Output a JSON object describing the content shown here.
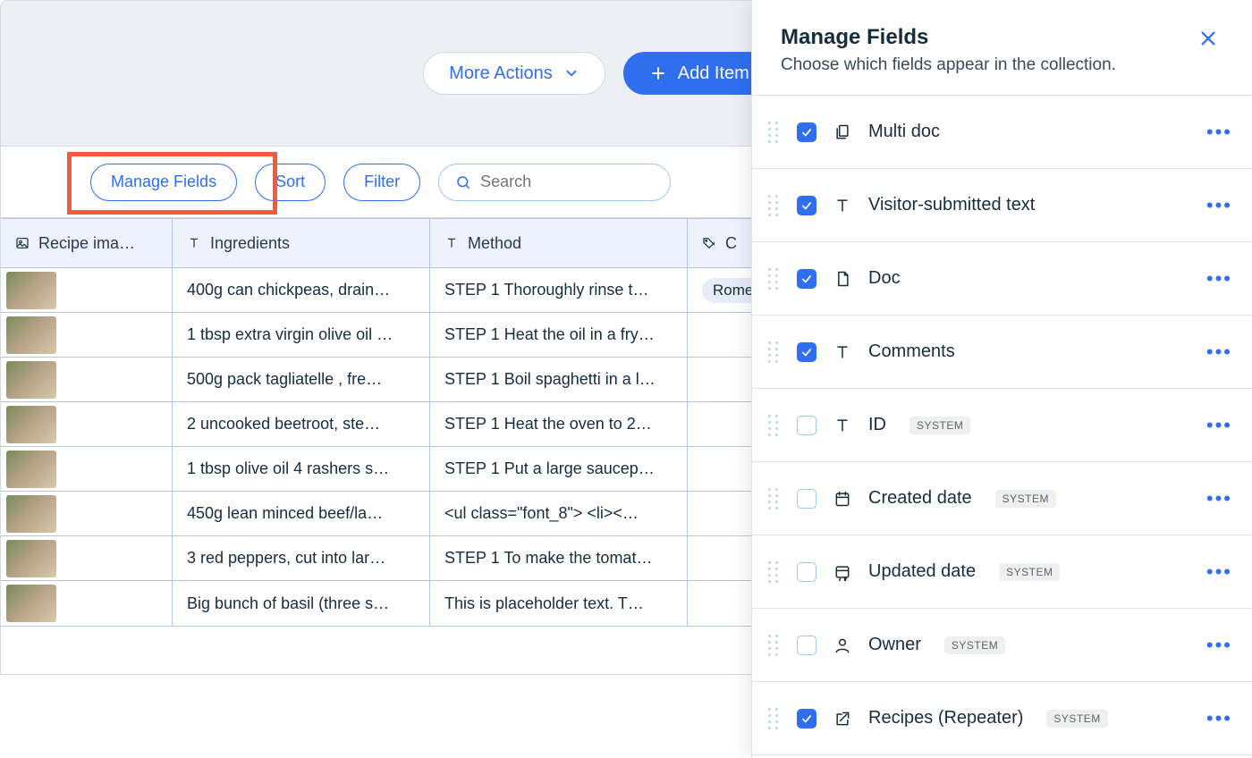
{
  "header": {
    "more_actions": "More Actions",
    "add_item": "Add Item"
  },
  "toolbar": {
    "manage_fields": "Manage Fields",
    "sort": "Sort",
    "filter": "Filter",
    "search_placeholder": "Search"
  },
  "table": {
    "columns": {
      "recipe_image": "Recipe ima…",
      "ingredients": "Ingredients",
      "method": "Method",
      "cu": "Cu"
    },
    "rows": [
      {
        "ingredients": "400g can chickpeas, drain…",
        "method": "STEP 1 Thoroughly rinse t…",
        "cu": "Rome"
      },
      {
        "ingredients": "1 tbsp extra virgin olive oil …",
        "method": "STEP 1 Heat the oil in a fry…",
        "cu": ""
      },
      {
        "ingredients": "500g pack tagliatelle , fre…",
        "method": "STEP 1 Boil spaghetti in a l…",
        "cu": ""
      },
      {
        "ingredients": "2 uncooked beetroot, ste…",
        "method": "STEP 1 Heat the oven to 2…",
        "cu": ""
      },
      {
        "ingredients": "1 tbsp olive oil 4 rashers s…",
        "method": "STEP 1 Put a large saucep…",
        "cu": ""
      },
      {
        "ingredients": "450g lean minced beef/la…",
        "method": "<ul class=\"font_8\"> <li><…",
        "cu": ""
      },
      {
        "ingredients": "3 red peppers, cut into lar…",
        "method": "STEP 1 To make the tomat…",
        "cu": ""
      },
      {
        "ingredients": "Big bunch of basil (three s…",
        "method": "This is placeholder text. T…",
        "cu": ""
      }
    ]
  },
  "panel": {
    "title": "Manage Fields",
    "subtitle": "Choose which fields appear in the collection.",
    "fields": [
      {
        "label": "Multi doc",
        "checked": true,
        "icon": "multidoc",
        "system": false
      },
      {
        "label": "Visitor-submitted text",
        "checked": true,
        "icon": "text",
        "system": false
      },
      {
        "label": "Doc",
        "checked": true,
        "icon": "doc",
        "system": false
      },
      {
        "label": "Comments",
        "checked": true,
        "icon": "text",
        "system": false
      },
      {
        "label": "ID",
        "checked": false,
        "icon": "text",
        "system": true
      },
      {
        "label": "Created date",
        "checked": false,
        "icon": "calendar",
        "system": true
      },
      {
        "label": "Updated date",
        "checked": false,
        "icon": "calendar-sync",
        "system": true
      },
      {
        "label": "Owner",
        "checked": false,
        "icon": "person",
        "system": true
      },
      {
        "label": "Recipes (Repeater)",
        "checked": true,
        "icon": "link-out",
        "system": true
      }
    ],
    "system_label": "SYSTEM"
  }
}
